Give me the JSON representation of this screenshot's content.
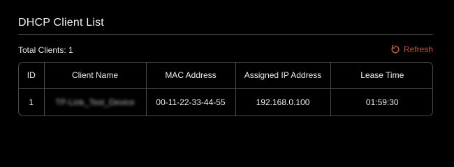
{
  "panel": {
    "title": "DHCP Client List",
    "total_label": "Total Clients:",
    "total_count": "1",
    "refresh_label": "Refresh"
  },
  "colors": {
    "accent": "#c8523a",
    "background": "#000000",
    "border": "#4a4a4a"
  },
  "table": {
    "headers": [
      "ID",
      "Client Name",
      "MAC Address",
      "Assigned IP Address",
      "Lease Time"
    ],
    "rows": [
      {
        "id": "1",
        "client_name": "TP-Link_Test_Device",
        "mac": "00-11-22-33-44-55",
        "ip": "192.168.0.100",
        "lease": "01:59:30"
      }
    ]
  },
  "icons": {
    "refresh": "refresh-icon"
  }
}
